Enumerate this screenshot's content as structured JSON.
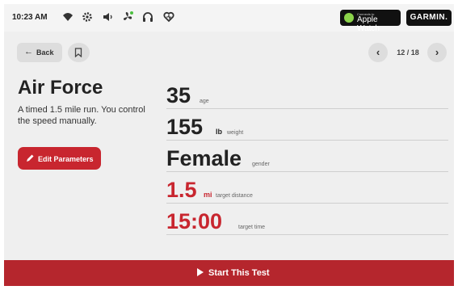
{
  "status_bar": {
    "time": "10:23 AM",
    "icons": [
      "wifi-icon",
      "settings-gear-icon",
      "speaker-icon",
      "fan-icon",
      "headphones-icon",
      "heart-rate-icon"
    ],
    "apple_watch": {
      "top": "Connects to",
      "label": "Apple Watch"
    },
    "garmin": "GARMIN."
  },
  "nav": {
    "back_label": "Back",
    "prev_glyph": "‹",
    "next_glyph": "›",
    "page_indicator": "12 / 18"
  },
  "workout": {
    "title": "Air Force",
    "description": "A timed 1.5 mile run. You control the speed manually.",
    "edit_button_label": "Edit Parameters"
  },
  "stats": {
    "age": {
      "value": "35",
      "caption": "age"
    },
    "weight": {
      "value": "155",
      "unit": "lb",
      "caption": "weight"
    },
    "gender": {
      "value": "Female",
      "caption": "gender"
    },
    "distance": {
      "value": "1.5",
      "unit": "mi",
      "caption": "target distance"
    },
    "time": {
      "value": "15:00",
      "caption": "target time"
    }
  },
  "footer": {
    "start_label": "Start This Test"
  },
  "colors": {
    "accent": "#c8262f",
    "footer": "#b5262d",
    "background": "#efefef"
  }
}
